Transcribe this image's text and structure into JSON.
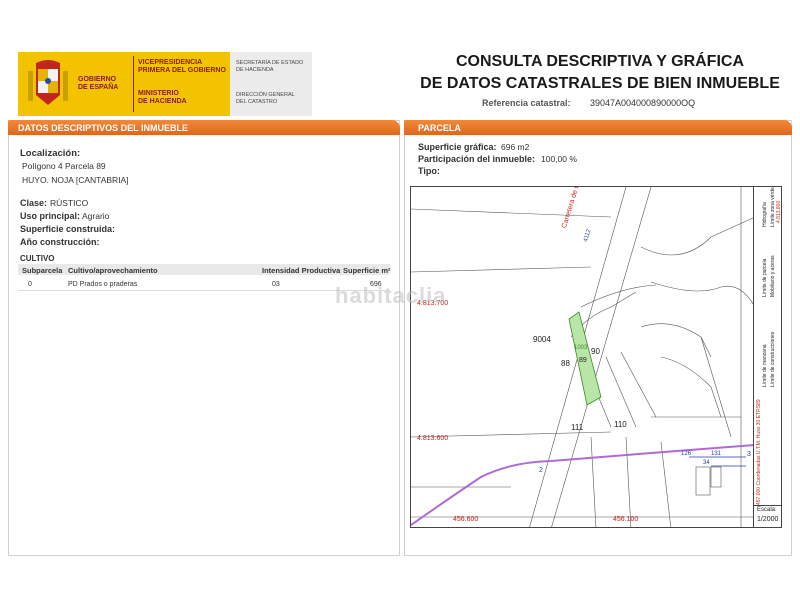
{
  "header": {
    "gov_name": [
      "GOBIERNO",
      "DE ESPAÑA"
    ],
    "vice": [
      "VICEPRESIDENCIA",
      "PRIMERA DEL GOBIERNO"
    ],
    "ministry": [
      "MINISTERIO",
      "DE HACIENDA"
    ],
    "secretaria": [
      "SECRETARÍA DE ESTADO",
      "DE HACIENDA"
    ],
    "direccion": [
      "DIRECCIÓN GENERAL",
      "DEL CATASTRO"
    ],
    "title_line1": "CONSULTA DESCRIPTIVA Y GRÁFICA",
    "title_line2": "DE DATOS CATASTRALES DE BIEN INMUEBLE",
    "ref_label": "Referencia catastral:",
    "ref_value": "39047A004000890000OQ"
  },
  "left": {
    "bar_title": "DATOS DESCRIPTIVOS DEL INMUEBLE",
    "loc_label": "Localización:",
    "loc_line1": "Polígono 4 Parcela 89",
    "loc_line2": "HUYO. NOJA [CANTABRIA]",
    "clase_label": "Clase:",
    "clase_value": "RÚSTICO",
    "uso_label": "Uso principal:",
    "uso_value": "Agrario",
    "sup_label": "Superficie construida:",
    "anio_label": "Año construcción:",
    "cultivo_label": "CULTIVO",
    "table_headers": [
      "Subparcela",
      "Cultivo/aprovechamiento",
      "Intensidad Productiva",
      "Superficie m²"
    ],
    "table_row": [
      "0",
      "PD Prados o praderas",
      "03",
      "696"
    ],
    "watermark": "habitaclia"
  },
  "right": {
    "bar_title": "PARCELA",
    "sup_label": "Superficie gráfica:",
    "sup_value": "696 m2",
    "part_label": "Participación del inmueble:",
    "part_value": "100,00 %",
    "tipo_label": "Tipo:",
    "map_labels": {
      "road": "Carretera de Castillo",
      "road_code": "4112",
      "coord_y1": "4.813.700",
      "coord_y2": "4.813.600",
      "coord_x1": "456.600",
      "coord_x2": "456.100",
      "p9004": "9004",
      "p88": "88",
      "p89": "89",
      "p90": "90",
      "p111": "111",
      "p110": "110",
      "p1003": "1003",
      "p2": "2",
      "p3": "3",
      "p34": "34",
      "p126": "126",
      "p131": "131"
    },
    "legend": [
      "Límite de manzana",
      "Límite de parcela",
      "Límite de construcciones",
      "Mobiliario y aceras",
      "Límite zona verde",
      "Hidrografía"
    ],
    "legend_coords": "457.000 Coordenadas U.T.M. Huso 30 ETRS89",
    "legend_red": "4.813.800",
    "escala_label": "Escala:",
    "escala_value": "1/2000"
  },
  "colors": {
    "orange": "#e2651a",
    "yellow": "#f3c300",
    "parcel_green": "#b9e6a6",
    "hydro": "#b06ad6"
  }
}
